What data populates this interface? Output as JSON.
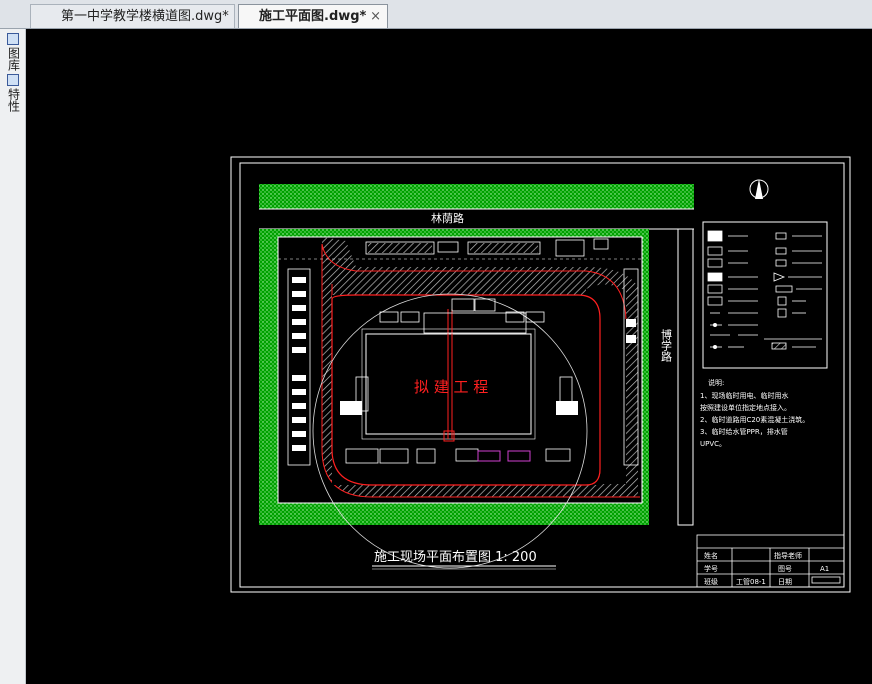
{
  "tabs": [
    {
      "label": "第一中学教学楼横道图.dwg*"
    },
    {
      "label": "施工平面图.dwg*",
      "active": true
    }
  ],
  "tab_close": "×",
  "sidebar": {
    "items": [
      {
        "label": "图库",
        "icon": "library-icon"
      },
      {
        "label": "特性",
        "icon": "properties-icon"
      }
    ]
  },
  "drawing": {
    "road_top": "林荫路",
    "road_right": "博学路",
    "building": "拟 建 工 程",
    "title": "施工现场平面布置图 1: 200",
    "notes": {
      "heading": "说明:",
      "lines": [
        "1、现场临时用电、临时用水",
        "按照建设单位指定地点接入。",
        "2、临时道路用C20素混凝土浇筑。",
        "3、临时给水管PPR，排水管",
        "UPVC。"
      ]
    },
    "title_block": {
      "name_label": "姓名",
      "advisor_label": "指导老师",
      "id_label": "学号",
      "drawing_no_label": "图号",
      "drawing_no": "A1",
      "class_label": "班级",
      "class_value": "工管08-1",
      "date_label": "日期"
    }
  },
  "colors": {
    "canvas_bg": "#000000",
    "green_belt": "#00b000",
    "road_hatch": "#c8c8c8",
    "red_line": "#ff2020",
    "white_line": "#ffffff",
    "magenta": "#d040d0"
  }
}
